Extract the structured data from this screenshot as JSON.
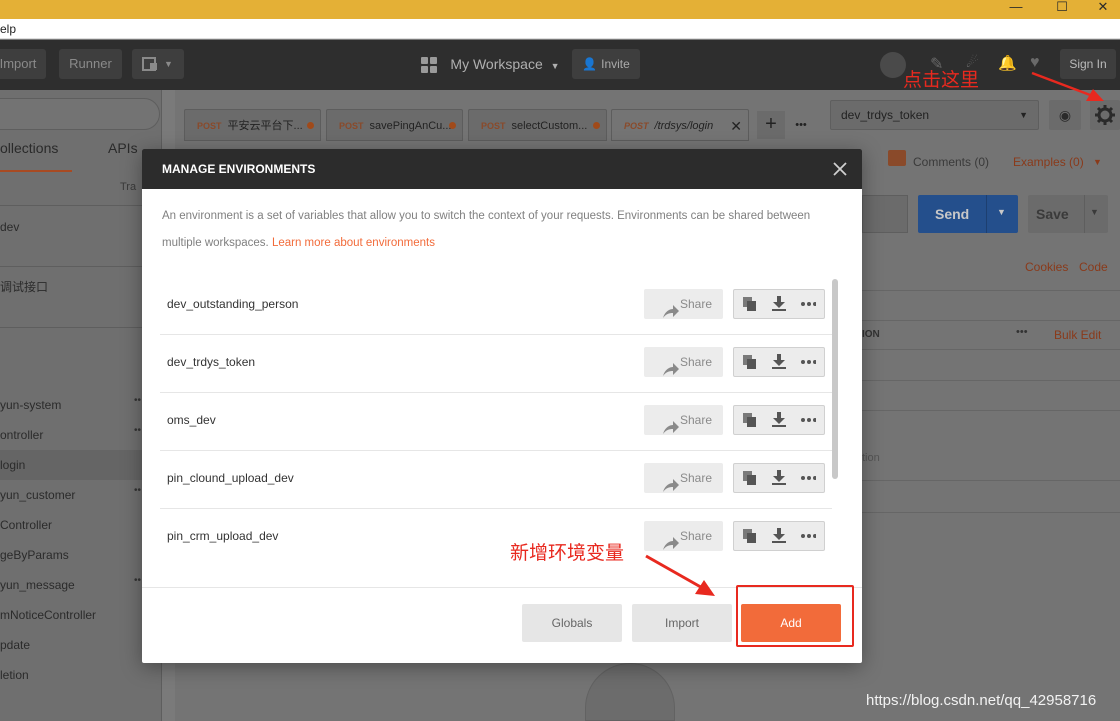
{
  "menubar": {
    "help_fragment": "elp"
  },
  "header": {
    "import_label": "Import",
    "runner_label": "Runner",
    "workspace_label": "My Workspace",
    "invite_label": "Invite",
    "signin_label": "Sign In"
  },
  "tabs": [
    {
      "method": "POST",
      "label": "平安云平台下..."
    },
    {
      "method": "POST",
      "label": "savePingAnCu..."
    },
    {
      "method": "POST",
      "label": "selectCustom..."
    },
    {
      "method": "POST",
      "label": "/trdsys/login"
    }
  ],
  "env_selector": {
    "selected": "dev_trdys_token"
  },
  "sidebar": {
    "tab_collections": "ollections",
    "tab_apis": "APIs",
    "trash_fragment": "Tra",
    "rows": [
      "dev",
      "调试接口",
      "yun-system",
      "ontroller",
      "login",
      "yun_customer",
      "Controller",
      "geByParams",
      "yun_message",
      "mNoticeController",
      "pdate",
      "letion"
    ]
  },
  "request": {
    "comments_label": "Comments (0)",
    "examples_label": "Examples (0)",
    "send_label": "Send",
    "save_label": "Save",
    "cookies_label": "Cookies",
    "code_label": "Code",
    "col_fragment": "ION",
    "bulk_edit_label": "Bulk Edit",
    "desc_fragment": "tion"
  },
  "modal": {
    "title": "MANAGE ENVIRONMENTS",
    "description": "An environment is a set of variables that allow you to switch the context of your requests. Environments can be shared between multiple workspaces.",
    "learn_more": "Learn more about environments",
    "share_label": "Share",
    "environments": [
      "dev_outstanding_person",
      "dev_trdys_token",
      "oms_dev",
      "pin_clound_upload_dev",
      "pin_crm_upload_dev"
    ],
    "globals_label": "Globals",
    "import_label": "Import",
    "add_label": "Add"
  },
  "annotations": {
    "settings_hint": "点击这里",
    "add_hint": "新增环境变量"
  },
  "watermark": "https://blog.csdn.net/qq_42958716",
  "colors": {
    "accent": "#f26b3a",
    "send": "#2d6ec9",
    "annotation": "#e8291f",
    "titlebar": "#e4b036"
  }
}
